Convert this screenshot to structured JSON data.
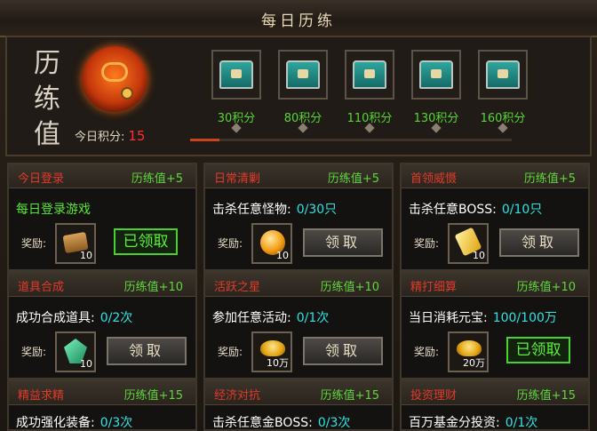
{
  "title": "每日历练",
  "emblem_text": "历练值",
  "today_score_label": "今日积分:",
  "today_score": "15",
  "progress_fraction": 0.09,
  "milestones": [
    {
      "points": "30积分"
    },
    {
      "points": "80积分"
    },
    {
      "points": "110积分"
    },
    {
      "points": "130积分"
    },
    {
      "points": "160积分"
    }
  ],
  "reward_label": "奖励:",
  "cards": [
    {
      "name": "今日登录",
      "value": "历练值+5",
      "task": "每日登录游戏",
      "progress": "",
      "reward_icon": "scroll-icon",
      "reward_count": "10",
      "button": "已领取",
      "claimed": true
    },
    {
      "name": "日常清剿",
      "value": "历练值+5",
      "task": "击杀任意怪物:",
      "progress": "0/30只",
      "reward_icon": "orb-icon",
      "reward_count": "10",
      "button": "领取",
      "claimed": false
    },
    {
      "name": "首领威慑",
      "value": "历练值+5",
      "task": "击杀任意BOSS:",
      "progress": "0/10只",
      "reward_icon": "token-icon",
      "reward_count": "10",
      "button": "领取",
      "claimed": false
    },
    {
      "name": "道具合成",
      "value": "历练值+10",
      "task": "成功合成道具:",
      "progress": "0/2次",
      "reward_icon": "gem-icon",
      "reward_count": "10",
      "button": "领取",
      "claimed": false
    },
    {
      "name": "活跃之星",
      "value": "历练值+10",
      "task": "参加任意活动:",
      "progress": "0/1次",
      "reward_icon": "gold-ingot-icon",
      "reward_count": "10万",
      "button": "领取",
      "claimed": false
    },
    {
      "name": "精打细算",
      "value": "历练值+10",
      "task": "当日消耗元宝:",
      "progress": "100/100万",
      "reward_icon": "gold-ingot-icon",
      "reward_count": "20万",
      "button": "已领取",
      "claimed": true
    },
    {
      "name": "精益求精",
      "value": "历练值+15",
      "task": "成功强化装备:",
      "progress": "0/3次",
      "reward_icon": "",
      "reward_count": "",
      "button": "",
      "claimed": false
    },
    {
      "name": "经济对抗",
      "value": "历练值+15",
      "task": "击杀任意金BOSS:",
      "progress": "0/3次",
      "reward_icon": "",
      "reward_count": "",
      "button": "",
      "claimed": false
    },
    {
      "name": "投资理财",
      "value": "历练值+15",
      "task": "百万基金分投资:",
      "progress": "0/1次",
      "reward_icon": "",
      "reward_count": "",
      "button": "",
      "claimed": false
    }
  ]
}
